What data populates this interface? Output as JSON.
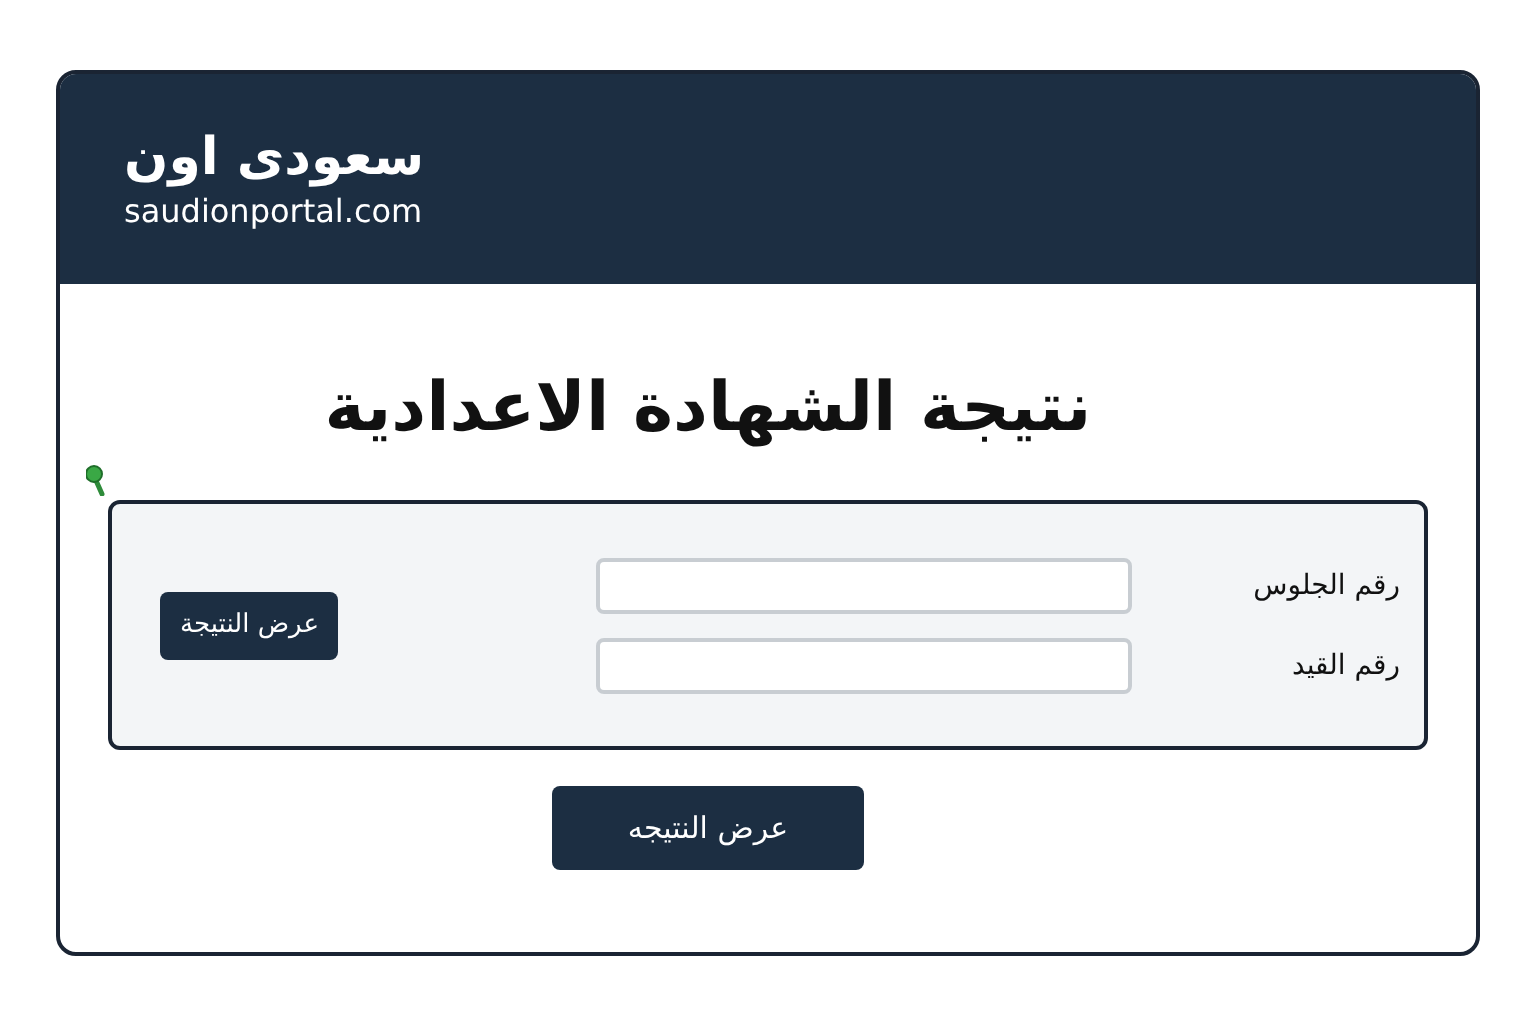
{
  "header": {
    "logo": "سعودى اون",
    "domain": "saudionportal.com"
  },
  "title": "نتيجة الشهادة الاعدادية",
  "form": {
    "fields": [
      {
        "label": "رقم الجلوس"
      },
      {
        "label": "رقم القيد"
      }
    ],
    "button": "عرض النتيجة"
  },
  "submit_button": "عرض النتيجه"
}
